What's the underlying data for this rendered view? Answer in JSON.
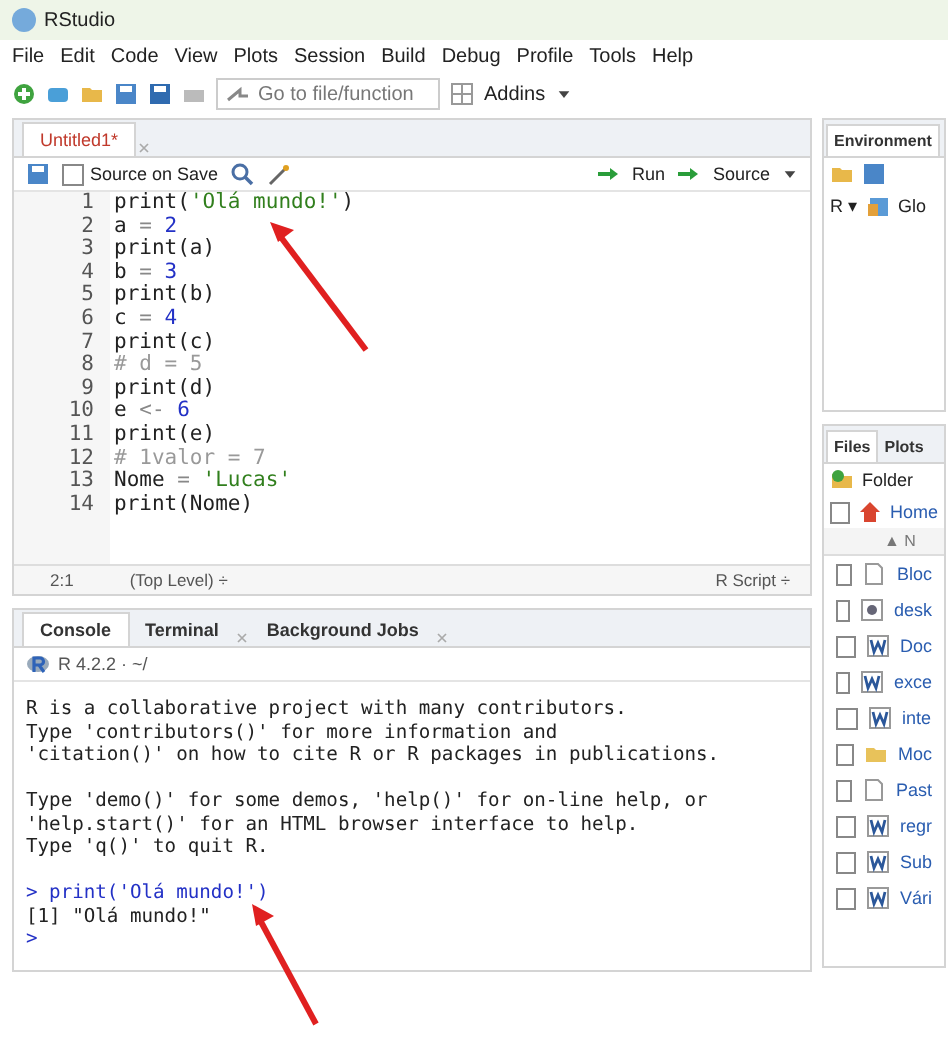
{
  "window": {
    "title": "RStudio"
  },
  "menu": [
    "File",
    "Edit",
    "Code",
    "View",
    "Plots",
    "Session",
    "Build",
    "Debug",
    "Profile",
    "Tools",
    "Help"
  ],
  "toolbar": {
    "goto_placeholder": "Go to file/function",
    "addins": "Addins"
  },
  "editor": {
    "tabs": [
      {
        "label": "Untitled1*",
        "selected": true
      }
    ],
    "source_on_save": {
      "label": "Source on Save",
      "checked": false
    },
    "run": "Run",
    "source": "Source",
    "lines": [
      {
        "number": "1",
        "tokens": [
          {
            "kind": "plain",
            "text": "print("
          },
          {
            "kind": "string",
            "text": "'Olá mundo!'"
          },
          {
            "kind": "plain",
            "text": ")"
          }
        ]
      },
      {
        "number": "2",
        "tokens": [
          {
            "kind": "plain",
            "text": "a "
          },
          {
            "kind": "op",
            "text": "="
          },
          {
            "kind": "number",
            "text": " 2"
          }
        ]
      },
      {
        "number": "3",
        "tokens": [
          {
            "kind": "plain",
            "text": "print(a)"
          }
        ]
      },
      {
        "number": "4",
        "tokens": [
          {
            "kind": "plain",
            "text": "b "
          },
          {
            "kind": "op",
            "text": "="
          },
          {
            "kind": "number",
            "text": " 3"
          }
        ]
      },
      {
        "number": "5",
        "tokens": [
          {
            "kind": "plain",
            "text": "print(b)"
          }
        ]
      },
      {
        "number": "6",
        "tokens": [
          {
            "kind": "plain",
            "text": "c "
          },
          {
            "kind": "op",
            "text": "="
          },
          {
            "kind": "number",
            "text": " 4"
          }
        ]
      },
      {
        "number": "7",
        "tokens": [
          {
            "kind": "plain",
            "text": "print(c)"
          }
        ]
      },
      {
        "number": "8",
        "tokens": [
          {
            "kind": "comment",
            "text": "# d = 5"
          }
        ]
      },
      {
        "number": "9",
        "tokens": [
          {
            "kind": "plain",
            "text": "print(d)"
          }
        ]
      },
      {
        "number": "10",
        "tokens": [
          {
            "kind": "plain",
            "text": "e "
          },
          {
            "kind": "op",
            "text": "<-"
          },
          {
            "kind": "number",
            "text": " 6"
          }
        ]
      },
      {
        "number": "11",
        "tokens": [
          {
            "kind": "plain",
            "text": "print(e)"
          }
        ]
      },
      {
        "number": "12",
        "tokens": [
          {
            "kind": "comment",
            "text": "# 1valor = 7"
          }
        ]
      },
      {
        "number": "13",
        "tokens": [
          {
            "kind": "plain",
            "text": "Nome "
          },
          {
            "kind": "op",
            "text": "="
          },
          {
            "kind": "string",
            "text": " 'Lucas'"
          }
        ]
      },
      {
        "number": "14",
        "tokens": [
          {
            "kind": "plain",
            "text": "print(Nome)"
          }
        ]
      }
    ],
    "status": {
      "position": "2:1",
      "scope": "(Top Level) ÷",
      "filetype": "R Script ÷"
    }
  },
  "console": {
    "tabs": [
      {
        "label": "Console",
        "selected": true,
        "closable": false
      },
      {
        "label": "Terminal",
        "selected": false,
        "closable": true
      },
      {
        "label": "Background Jobs",
        "selected": false,
        "closable": true
      }
    ],
    "version": "R 4.2.2 · ~/",
    "lines": [
      {
        "kind": "output",
        "text": "R is a collaborative project with many contributors."
      },
      {
        "kind": "output",
        "text": "Type 'contributors()' for more information and"
      },
      {
        "kind": "output",
        "text": "'citation()' on how to cite R or R packages in publications."
      },
      {
        "kind": "blank"
      },
      {
        "kind": "output",
        "text": "Type 'demo()' for some demos, 'help()' for on-line help, or"
      },
      {
        "kind": "output",
        "text": "'help.start()' for an HTML browser interface to help."
      },
      {
        "kind": "output",
        "text": "Type 'q()' to quit R."
      },
      {
        "kind": "blank"
      },
      {
        "kind": "input",
        "text": "> print('Olá mundo!')"
      },
      {
        "kind": "output",
        "text": "[1] \"Olá mundo!\""
      },
      {
        "kind": "prompt",
        "text": ">"
      }
    ]
  },
  "environment": {
    "tab": "Environment",
    "language": "R ▾",
    "scope": "Glo"
  },
  "files": {
    "tabs": [
      {
        "label": "Files",
        "selected": true
      },
      {
        "label": "Plots",
        "selected": false
      }
    ],
    "folder": "Folder",
    "home": "Home",
    "select_all_checked": false,
    "column": "▲ N",
    "items": [
      {
        "kind": "file",
        "name": "Bloc",
        "checked": false
      },
      {
        "kind": "settings",
        "name": "desk",
        "checked": false
      },
      {
        "kind": "word",
        "name": "Doc",
        "checked": false
      },
      {
        "kind": "word",
        "name": "exce",
        "checked": false
      },
      {
        "kind": "word",
        "name": "inte",
        "checked": false
      },
      {
        "kind": "folder",
        "name": "Moc",
        "checked": false
      },
      {
        "kind": "file",
        "name": "Past",
        "checked": false
      },
      {
        "kind": "word",
        "name": "regr",
        "checked": false
      },
      {
        "kind": "word",
        "name": "Sub",
        "checked": false
      },
      {
        "kind": "word",
        "name": "Vári",
        "checked": false
      }
    ]
  }
}
